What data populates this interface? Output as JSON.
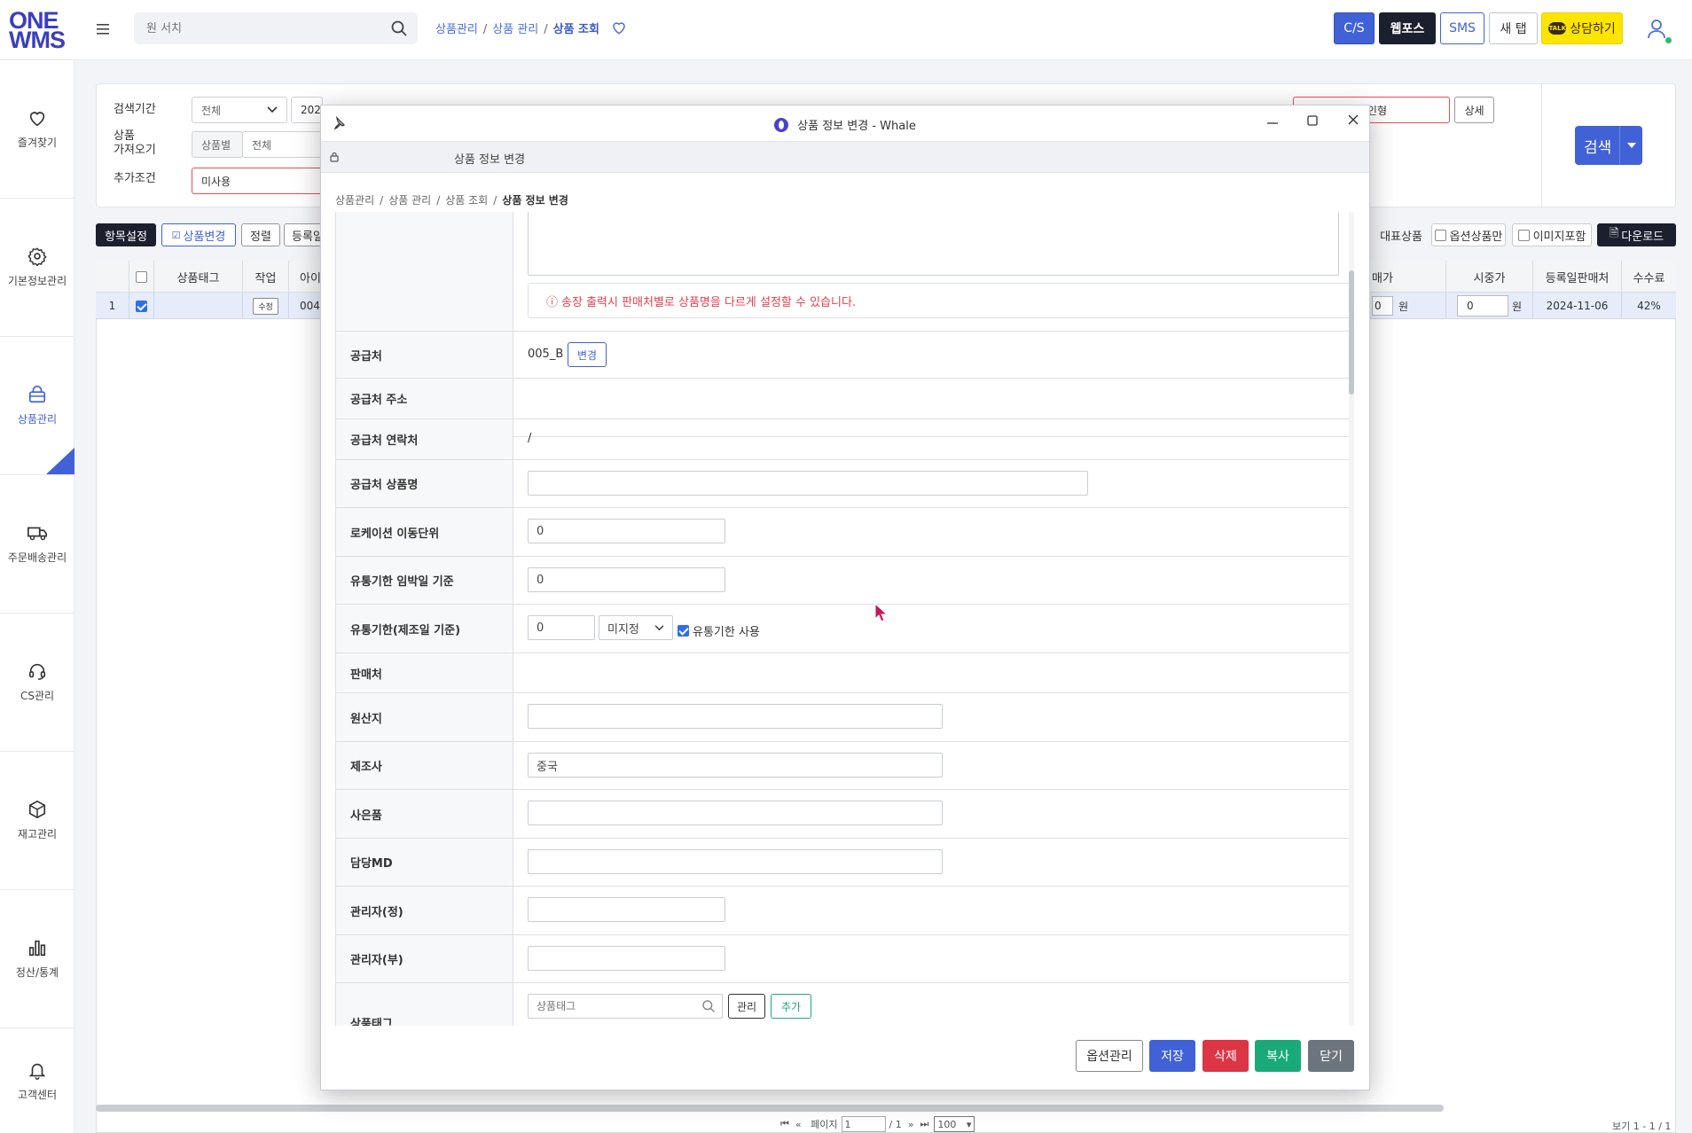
{
  "topbar": {
    "logo_line1": "ONE",
    "logo_line2": "WMS",
    "search_placeholder": "원 서치",
    "breadcrumb": [
      "상품관리",
      "상품 관리",
      "상품 조회"
    ],
    "buttons": {
      "cs": "C/S",
      "webforce": "웹포스",
      "sms": "SMS",
      "newtab": "새 탭",
      "consult": "상담하기",
      "talk": "TALK"
    }
  },
  "sidebar": {
    "items": [
      {
        "label": "즐겨찾기",
        "icon": "heart-icon"
      },
      {
        "label": "기본정보관리",
        "icon": "gear-icon"
      },
      {
        "label": "상품관리",
        "icon": "bag-icon",
        "active": true
      },
      {
        "label": "주문배송관리",
        "icon": "truck-icon"
      },
      {
        "label": "CS관리",
        "icon": "headset-icon"
      },
      {
        "label": "재고관리",
        "icon": "box-icon"
      },
      {
        "label": "정산/통계",
        "icon": "bar-chart-icon"
      },
      {
        "label": "고객센터",
        "icon": "bell-icon"
      }
    ]
  },
  "filter": {
    "period_label": "검색기간",
    "period_value": "전체",
    "date_value": "202",
    "import_label_1": "상품",
    "import_label_2": "가져오기",
    "import_by": "상품별",
    "import_value": "전체",
    "extra_label": "추가조건",
    "extra_value": "미사용",
    "keyword_partial": "인형",
    "detail_button": "상세",
    "search_button": "검색"
  },
  "toolbar": {
    "settings": "항목설정",
    "change": "상품변경",
    "sort": "정렬",
    "register_partial": "등록일",
    "rep_product": "대표상품",
    "option_only": "옵션상품만",
    "include_images": "이미지포함",
    "download": "다운로드"
  },
  "grid": {
    "headers": {
      "tag": "상품태그",
      "action": "작업",
      "id_partial": "아이",
      "price_partial": "매가",
      "market_price": "시중가",
      "reg_shop": "등록일판매처",
      "fee": "수수료"
    },
    "row": {
      "no": "1",
      "edit": "수정",
      "id_partial": "004",
      "price_partial": "0",
      "won": "원",
      "market_price": "0",
      "won2": "원",
      "reg_shop": "2024-11-06",
      "fee": "42%"
    }
  },
  "pager": {
    "page_label": "페이지",
    "page_value": "1",
    "total": "/ 1",
    "page_size": "100",
    "view_count": "보기 1 - 1 / 1"
  },
  "modal": {
    "window_title": "상품 정보 변경 - Whale",
    "address_title": "상품 정보 변경",
    "breadcrumb": [
      "상품관리",
      "상품 관리",
      "상품 조회",
      "상품 정보 변경"
    ],
    "notice": "송장 출력시 판매처별로 상품명을 다르게 설정할 수 있습니다.",
    "fields": {
      "supplier_label": "공급처",
      "supplier_value": "005_B",
      "supplier_change": "변경",
      "supplier_addr_label": "공급처 주소",
      "supplier_contact_label": "공급처 연락처",
      "supplier_contact_value": "/",
      "supplier_product_label": "공급처 상품명",
      "location_unit_label": "로케이션 이동단위",
      "location_unit_value": "0",
      "expiry_near_label": "유통기한 임박일 기준",
      "expiry_near_value": "0",
      "expiry_mfg_label": "유통기한(제조일 기준)",
      "expiry_mfg_value": "0",
      "expiry_mfg_select": "미지정",
      "expiry_use_label": "유통기한 사용",
      "shop_label": "판매처",
      "origin_label": "원산지",
      "maker_label": "제조사",
      "maker_value": "중국",
      "gift_label": "사은품",
      "md_label": "담당MD",
      "manager_main_label": "관리자(정)",
      "manager_sub_label": "관리자(부)",
      "tag_label": "상품태그",
      "tag_placeholder": "상품태그",
      "tag_manage": "관리",
      "tag_add": "추가"
    },
    "buttons": {
      "options": "옵션관리",
      "save": "저장",
      "delete": "삭제",
      "copy": "복사",
      "close": "닫기"
    },
    "colors": {
      "save": "#4062d6",
      "delete": "#dc3545",
      "copy": "#1aaa7a",
      "close": "#6c757d"
    }
  }
}
